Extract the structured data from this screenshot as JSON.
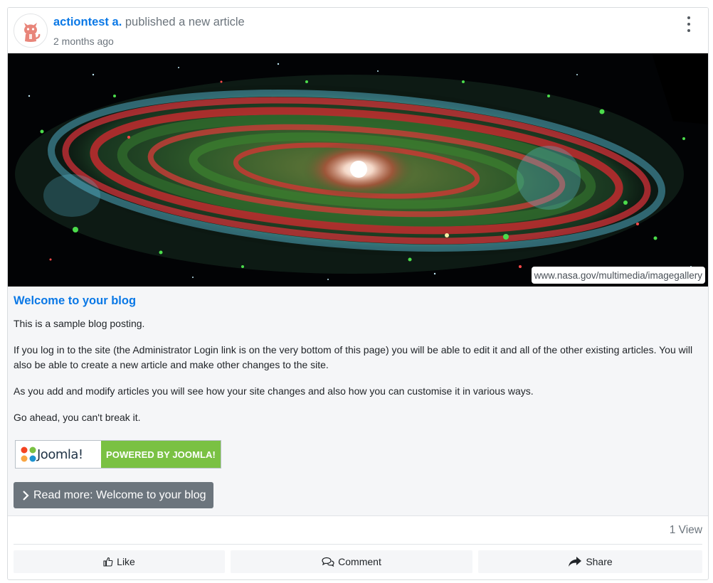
{
  "post": {
    "author": "actiontest a.",
    "action": "published a new article",
    "time": "2 months ago"
  },
  "image": {
    "credit": "www.nasa.gov/multimedia/imagegallery"
  },
  "article": {
    "title": "Welcome to your blog",
    "paragraphs": [
      "This is a sample blog posting.",
      "If you log in to the site (the Administrator Login link is on the very bottom of this page) you will be able to edit it and all of the other existing articles. You will also be able to create a new article and make other changes to the site.",
      "As you add and modify articles you will see how your site changes and also how you can customise it in various ways.",
      "Go ahead, you can't break it."
    ],
    "badge_logo": "Joomla!",
    "badge_text": "POWERED BY JOOMLA!",
    "read_more": "Read more: Welcome to your blog"
  },
  "stats": {
    "views": "1 View"
  },
  "actions": {
    "like": "Like",
    "comment": "Comment",
    "share": "Share"
  },
  "colors": {
    "accent": "#0a78e6",
    "badge_green": "#7ac143",
    "button_gray": "#6c757d"
  },
  "icons": [
    "cat-avatar-icon",
    "kebab-menu-icon",
    "chevron-right-icon",
    "thumbs-up-icon",
    "comment-icon",
    "share-icon",
    "joomla-logo-icon"
  ]
}
